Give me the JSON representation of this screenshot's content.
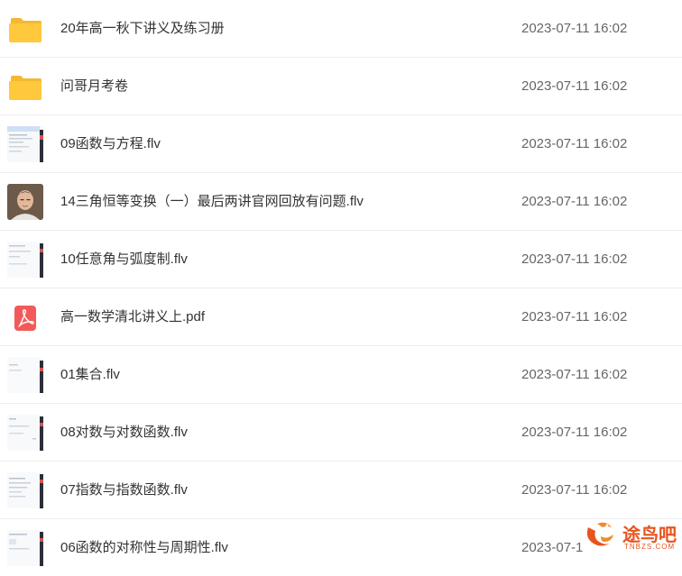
{
  "files": [
    {
      "name": "20年高一秋下讲义及练习册",
      "date": "2023-07-11 16:02",
      "icon": "folder-icon"
    },
    {
      "name": "问哥月考卷",
      "date": "2023-07-11 16:02",
      "icon": "folder-icon"
    },
    {
      "name": "09函数与方程.flv",
      "date": "2023-07-11 16:02",
      "icon": "video-thumbnail"
    },
    {
      "name": "14三角恒等变换（一）最后两讲官网回放有问题.flv",
      "date": "2023-07-11 16:02",
      "icon": "video-thumbnail"
    },
    {
      "name": "10任意角与弧度制.flv",
      "date": "2023-07-11 16:02",
      "icon": "video-thumbnail"
    },
    {
      "name": "高一数学清北讲义上.pdf",
      "date": "2023-07-11 16:02",
      "icon": "pdf-icon"
    },
    {
      "name": "01集合.flv",
      "date": "2023-07-11 16:02",
      "icon": "video-thumbnail"
    },
    {
      "name": "08对数与对数函数.flv",
      "date": "2023-07-11 16:02",
      "icon": "video-thumbnail"
    },
    {
      "name": "07指数与指数函数.flv",
      "date": "2023-07-11 16:02",
      "icon": "video-thumbnail"
    },
    {
      "name": "06函数的对称性与周期性.flv",
      "date": "2023-07-1",
      "icon": "video-thumbnail"
    }
  ],
  "watermark": {
    "text": "途鸟吧",
    "sub": "TNBZS.COM"
  },
  "colors": {
    "folder": "#ffc83d",
    "pdf": "#f25a5a",
    "watermark": "#e7541e",
    "divider": "#eeeeee"
  }
}
